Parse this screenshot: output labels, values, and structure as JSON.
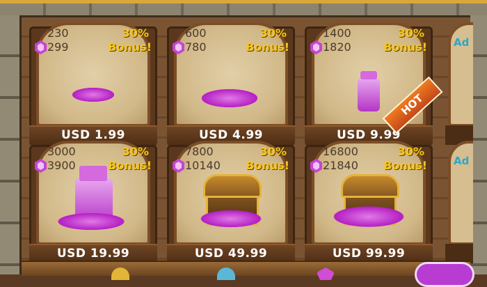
{
  "currency_icon": "gem-icon",
  "offers": [
    {
      "old_amount": "230",
      "new_amount": "299",
      "bonus_pct": "30%",
      "bonus_label": "Bonus!",
      "price": "USD 1.99",
      "art": "small-gem-pile"
    },
    {
      "old_amount": "600",
      "new_amount": "780",
      "bonus_pct": "30%",
      "bonus_label": "Bonus!",
      "price": "USD 4.99",
      "art": "gem-pile"
    },
    {
      "old_amount": "1400",
      "new_amount": "1820",
      "bonus_pct": "30%",
      "bonus_label": "Bonus!",
      "price": "USD 9.99",
      "art": "gem-jar",
      "ribbon": "HOT"
    },
    {
      "old_amount": "3000",
      "new_amount": "3900",
      "bonus_pct": "30%",
      "bonus_label": "Bonus!",
      "price": "USD 19.99",
      "art": "large-gem-jar"
    },
    {
      "old_amount": "7800",
      "new_amount": "10140",
      "bonus_pct": "30%",
      "bonus_label": "Bonus!",
      "price": "USD 49.99",
      "art": "treasure-chest"
    },
    {
      "old_amount": "16800",
      "new_amount": "21840",
      "bonus_pct": "30%",
      "bonus_label": "Bonus!",
      "price": "USD 99.99",
      "art": "overflowing-treasure-chest"
    }
  ],
  "partial_cards": [
    {
      "label": "Ad"
    },
    {
      "label": "Ad"
    }
  ],
  "colors": {
    "bonus": "#f8c719",
    "gem": "#c446d2",
    "ad_text": "#2aa7c9",
    "hot_ribbon": "#e0601c"
  }
}
